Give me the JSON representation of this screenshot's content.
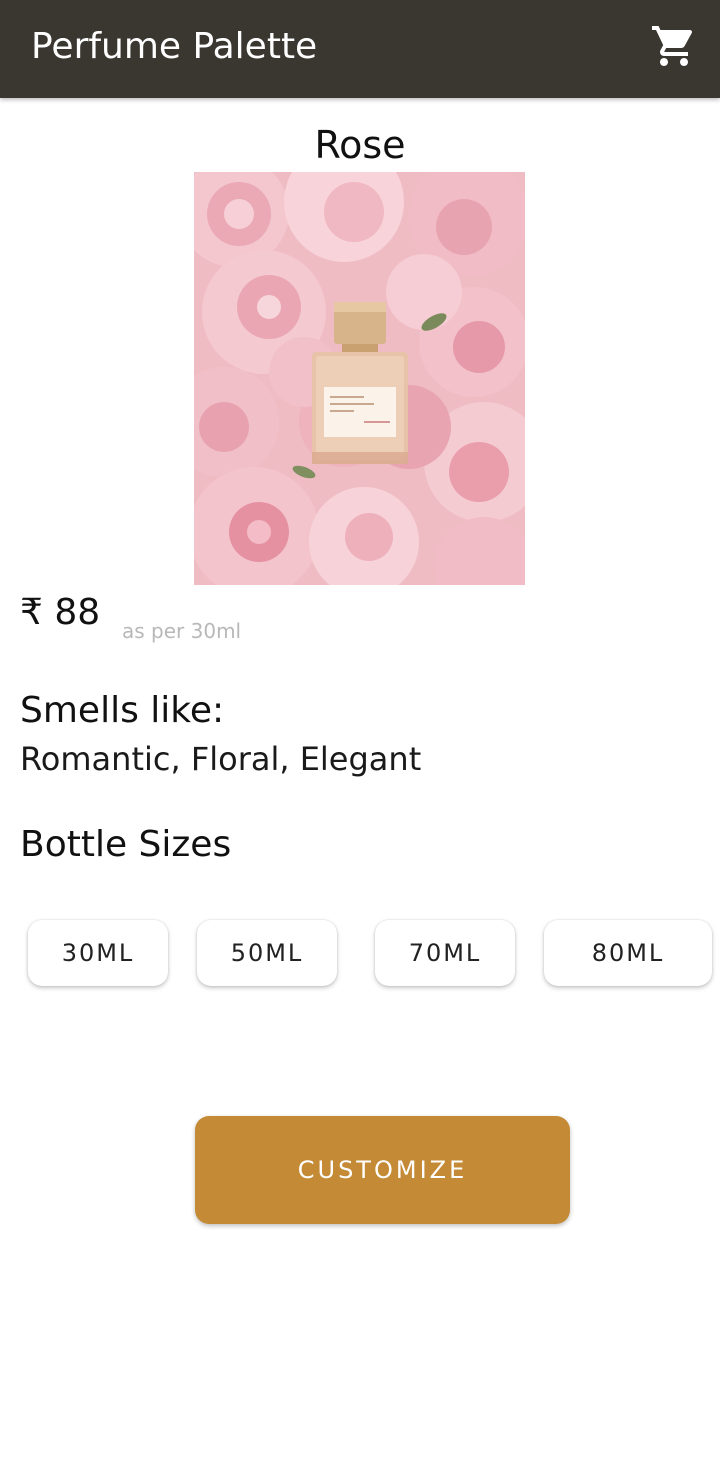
{
  "app_bar": {
    "title": "Perfume Palette",
    "cart_icon": "shopping-cart-icon",
    "background_color": "#3a3630"
  },
  "product": {
    "name": "Rose",
    "image": "rose-perfume-bottle-among-pink-roses",
    "price": "₹ 88",
    "price_note": "as per 30ml",
    "smells_heading": "Smells like:",
    "smells_value": "Romantic, Floral, Elegant",
    "sizes_heading": "Bottle Sizes",
    "sizes": [
      "30ML",
      "50ML",
      "70ML",
      "80ML"
    ]
  },
  "actions": {
    "customize_label": "CUSTOMIZE",
    "accent_color": "#c48a35"
  }
}
